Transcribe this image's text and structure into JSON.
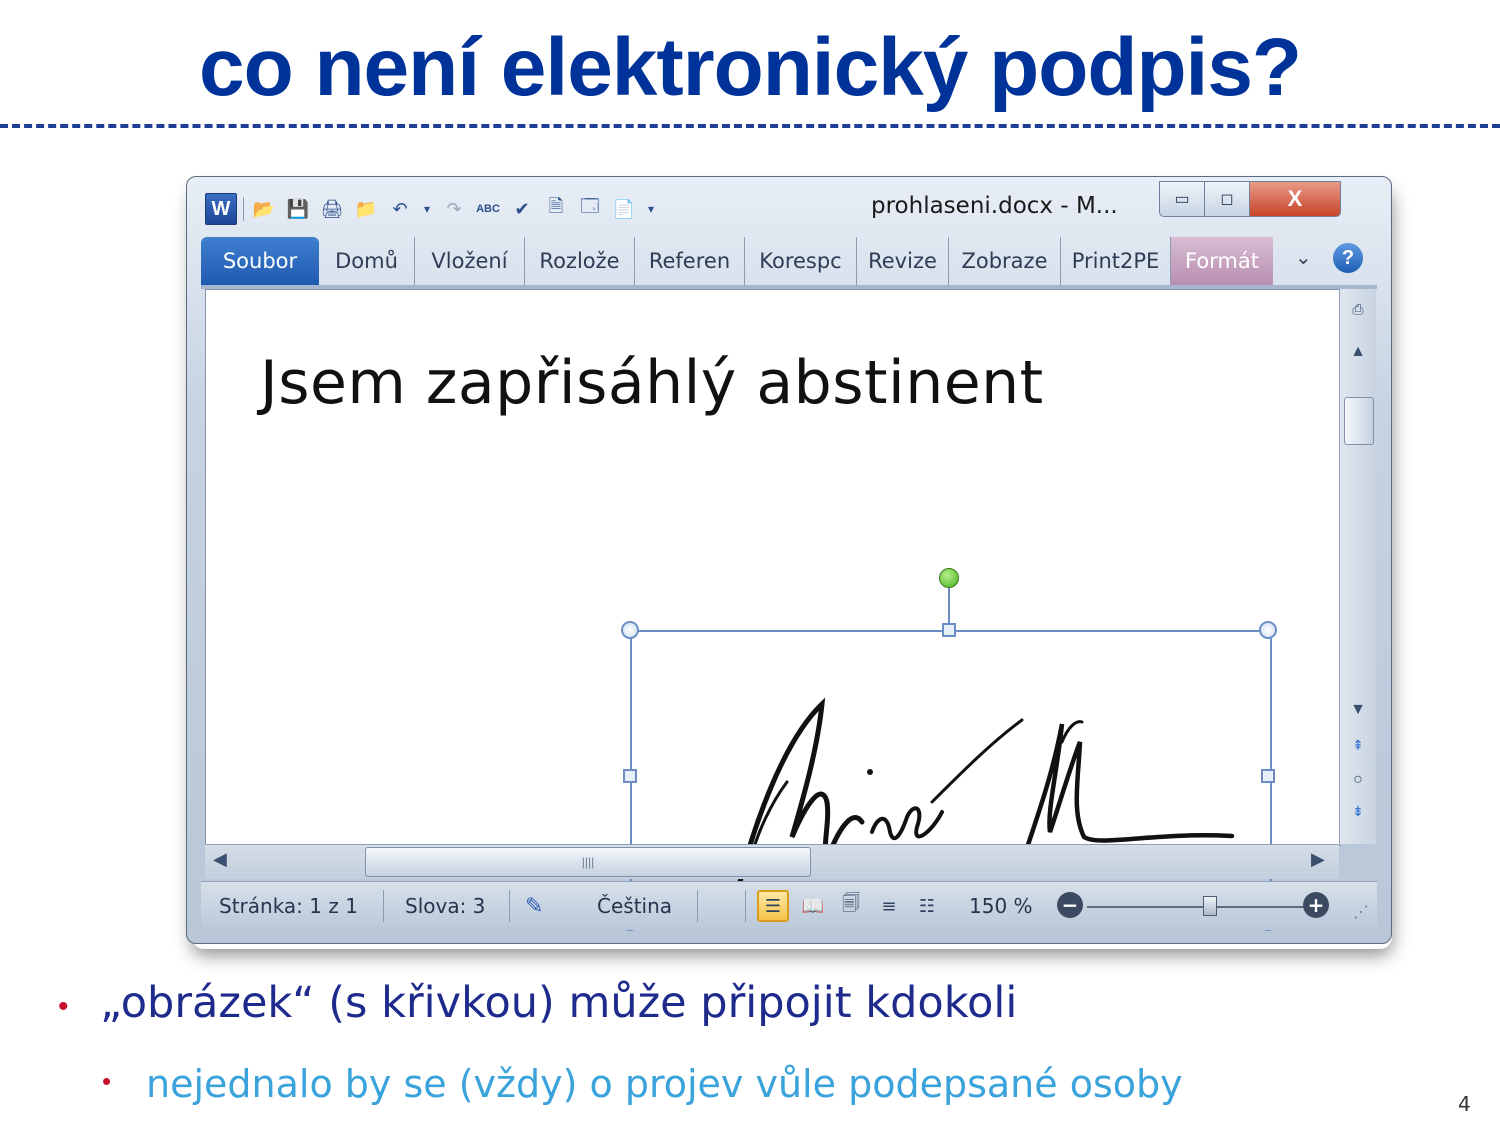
{
  "slide": {
    "title": "co není elektronický podpis?",
    "page_number": "4"
  },
  "window": {
    "title": "prohlaseni.docx  -  M...",
    "quick_access_icons": [
      "word-logo-icon",
      "open-folder-icon",
      "save-icon",
      "print-preview-icon",
      "folder-icon",
      "undo-icon",
      "dropdown-arrow-icon",
      "redo-icon",
      "abc-123-icon",
      "spelling-icon",
      "page-icon",
      "textbox-icon",
      "document-icon",
      "customize-arrow-icon"
    ],
    "controls": {
      "minimize": "▭",
      "maximize": "◻",
      "close": "X"
    }
  },
  "ribbon": {
    "tabs": [
      {
        "label": "Soubor"
      },
      {
        "label": "Domů"
      },
      {
        "label": "Vložení"
      },
      {
        "label": "Rozlože"
      },
      {
        "label": "Referen"
      },
      {
        "label": "Korespc"
      },
      {
        "label": "Revize"
      },
      {
        "label": "Zobraze"
      },
      {
        "label": "Print2PE"
      },
      {
        "label": "Formát"
      }
    ],
    "help": "?"
  },
  "document": {
    "text": "Jsem zapřisáhlý abstinent",
    "image": "handwritten-signature"
  },
  "status_bar": {
    "page": "Stránka: 1 z 1",
    "words": "Slova: 3",
    "language": "Čeština",
    "zoom": "150 %",
    "zoom_level": 150
  },
  "bullets": {
    "level1": "„obrázek“ (s křivkou) může připojit kdokoli",
    "level2": "nejednalo by se (vždy) o projev vůle podepsané osoby"
  },
  "colors": {
    "title": "#003399",
    "bullet_level1": "#1e2a8c",
    "bullet_level2": "#3aa3dc",
    "bullet_marker": "#c8102e"
  }
}
